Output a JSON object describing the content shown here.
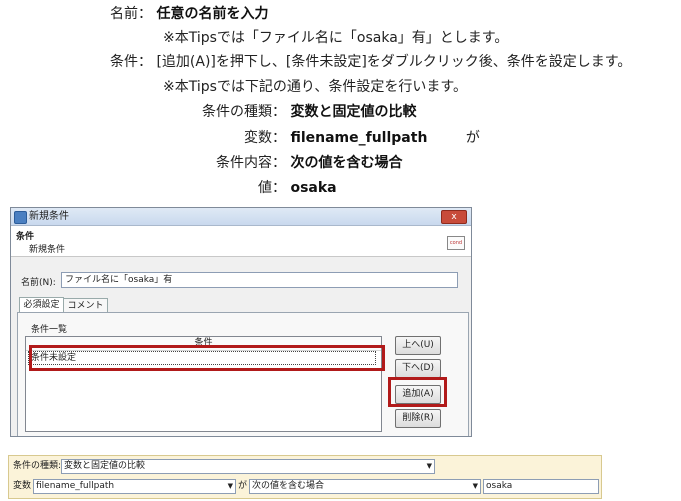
{
  "doc": {
    "name_label": "名前：",
    "name_value": "任意の名前を入力",
    "name_note": "※本Tipsでは「ファイル名に「osaka」有」とします。",
    "cond_label": "条件：",
    "cond_text": "[追加(A)]を押下し、[条件未設定]をダブルクリック後、条件を設定します。",
    "cond_note": "※本Tipsでは下記の通り、条件設定を行います。",
    "kind_label": "条件の種類：",
    "kind_value": "変数と固定値の比較",
    "var_label": "変数：",
    "var_value": "filename_fullpath",
    "var_suffix": "が",
    "content_label": "条件内容：",
    "content_value": "次の値を含む場合",
    "value_label": "値：",
    "value_value": "osaka"
  },
  "dialog": {
    "title": "新規条件",
    "close": "x",
    "header_title": "条件",
    "header_subtitle": "新規条件",
    "header_icon": "cond",
    "name_label": "名前(N):",
    "name_value": "ファイル名に「osaka」有",
    "tabs": [
      "必須設定",
      "コメント"
    ],
    "list_group_label": "条件一覧",
    "list_header": "条件",
    "list_rows": [
      "条件未設定"
    ],
    "buttons": {
      "up": "上へ(U)",
      "down": "下へ(D)",
      "add": "追加(A)",
      "delete": "削除(R)"
    }
  },
  "strip": {
    "kind_label": "条件の種類:",
    "kind_value": "変数と固定値の比較",
    "var_label": "変数",
    "var_value": "filename_fullpath",
    "ga": "が",
    "op_value": "次の値を含む場合",
    "value_value": "osaka"
  },
  "icons": [
    "app-icon",
    "close-icon",
    "cond-icon",
    "dropdown-arrow-icon"
  ],
  "colors": {
    "highlight": "#b11a1a",
    "strip_bg": "#fbf3d9"
  }
}
